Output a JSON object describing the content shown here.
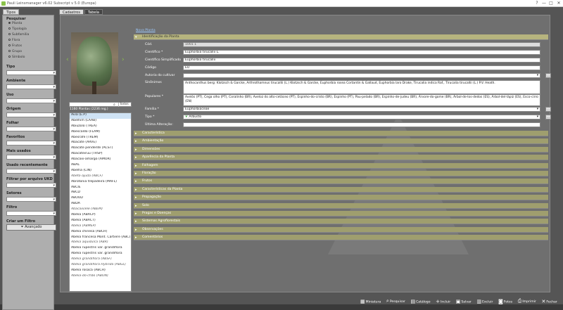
{
  "window": {
    "title": "Pauli Leinsmanager v6.02 Subscript v 5.0 (Europa)",
    "min": "—",
    "max": "□",
    "close": "✕",
    "help": "?"
  },
  "sidebar": {
    "tabs": [
      "Tipos"
    ],
    "sections": [
      {
        "label": "Pesquisar",
        "radios": [
          "Planta",
          "Tipologia",
          "Subfamília",
          "Flora",
          "Frutos",
          "Grupo",
          "Símbolo"
        ]
      },
      {
        "label": "Tipo"
      },
      {
        "label": "Ambiente"
      },
      {
        "label": "Uso"
      },
      {
        "label": "Origem"
      },
      {
        "label": "Folhar"
      },
      {
        "label": "Favoritos"
      },
      {
        "label": "Mais usados"
      },
      {
        "label": "Usado recentemente"
      },
      {
        "label": "Filtrar por arquivo UKD"
      },
      {
        "label": "Setores"
      },
      {
        "label": "Filtro"
      },
      {
        "label": "Criar um Filtro"
      }
    ],
    "advanced_button": "Avançado"
  },
  "main": {
    "tabs": [
      "Cadastros",
      "Tabela"
    ],
    "link": "Nova Planta",
    "search": {
      "placeholder": "",
      "select": "Todos"
    },
    "count": "1160 Plantas (2236 reg.)",
    "plants": [
      "Ávia (E.P)",
      "Abelhim (LAAB)",
      "Abiuzolo (TREA)",
      "Abescaldo (FLAM)",
      "Abesrafe (TREM)",
      "Abacate (ARVE)",
      "Abacate pendente (ACST)",
      "Abacateiruu (TRSP)",
      "Abacaxi-amargo (AMOR)",
      "ABAL",
      "Abelha (CIN)",
      "Abeto-ajuda (ABCF)",
      "Abrotonia trepadeira (MAFL)",
      "ABCIE",
      "ABCD",
      "ABOUD",
      "ABDA",
      "Abacaxi/ele (ABEM)",
      "Abélia (ABACP)",
      "Abélia (ABACT)",
      "Abélia (ABMEP)",
      "Abélia chinesa (ABCH)",
      "Abélia francesa Mont. Cartiere (ABC)",
      "Abélia aquidulca (ABR)",
      "Abélia rupestris var. grandiflora",
      "Abélia rupestris var. grandiflora",
      "Abélia grandiflora (ABSF)",
      "Abélia grandiflora Hybrida (ABGL)",
      "Abélia rosaca (ABCH)",
      "Abelia-do-chão (ABON)"
    ],
    "sections_open": "Identificação da Planta",
    "form": {
      "cod_label": "Cód.",
      "cod": "1001 1",
      "cient_label": "Científico *",
      "cient": "Euphorbia tirucallii L.",
      "cient_simpl_label": "Científico Simplificado",
      "cient_simpl": "Euphorbia tirucallii",
      "codigo_label": "Código",
      "codigo": "EU",
      "autor_label": "Autoria do cultivar",
      "autor": "",
      "sinonimo_label": "Sinônimos",
      "sinonimo": "Anthocanthus berg: Klotzsch & Garcke, Arthrothamnus tirucallii (L.) Klotzsch & Garcke, Euphorbia rosea Cortantin & Gallaud, Euphorbia laro Drake, Tirucalia indica Raf., Tirucalia tirucallii (L.) P.V. Heath.",
      "popular_label": "Populares *",
      "popular": "Avelós (PT), Cega olho (PT), Coralinho (BR), Aveloz do alto-cetáceo (PT), Espinho-do-cristo (BR), Espinho (PT), Pau-pelado (BR), Espinho-de-judeu (BR), Árvore-do-gome (BR), Árbol-de-los-dedos (ES), Árbol-del-lápiz (ES), Esco-cirro (EN)",
      "familia_label": "Família *",
      "familia": "Euphorbiaceae",
      "tipo_label": "Tipo *",
      "tipo": "Arbusto",
      "ultima_label": "Última Alteração:",
      "ultima": ""
    },
    "sections_closed": [
      "Característica",
      "Ambientação",
      "Dimensões",
      "Aparência da Planta",
      "Folhagem",
      "Floração",
      "Frutos",
      "Características da Planta",
      "Propagação",
      "Solo",
      "Pragas e Doenças",
      "Sistemas Agroflorestais",
      "Observações",
      "Comentários"
    ],
    "bottom": [
      "Miniatura",
      "Pesquisar",
      "Catálogo",
      "Incluir",
      "Salvar",
      "Excluir",
      "Fotos",
      "Imprimir",
      "Fechar"
    ]
  }
}
